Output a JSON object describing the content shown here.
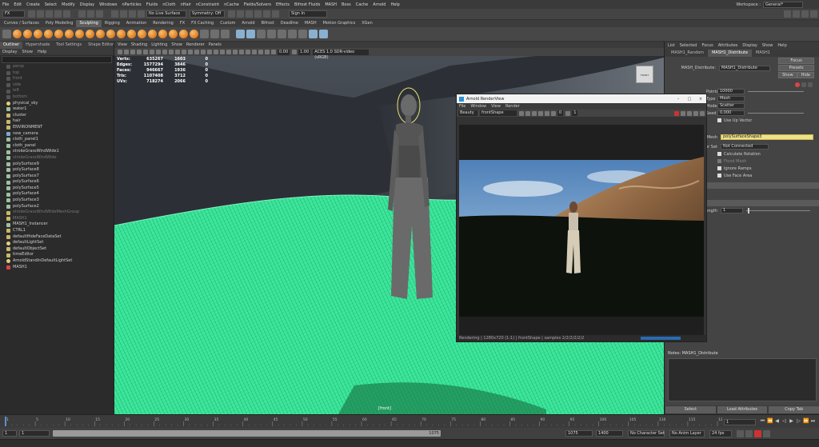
{
  "menubar": {
    "items": [
      "File",
      "Edit",
      "Create",
      "Select",
      "Modify",
      "Display",
      "Windows",
      "nParticles",
      "Fluids",
      "nCloth",
      "nHair",
      "nConstraint",
      "nCache",
      "Fields/Solvers",
      "Effects",
      "Bifrost Fluids",
      "MASH",
      "Boss",
      "Cache",
      "Arnold",
      "Help"
    ],
    "workspace_label": "Workspace :",
    "workspace_value": "General*"
  },
  "statusline": {
    "mode": "FX",
    "live_surface": "No Live Surface",
    "symmetry": "Symmetry: Off",
    "sign_in": "Sign In"
  },
  "shelf_tabs": [
    "Curves / Surfaces",
    "Poly Modeling",
    "Sculpting",
    "Rigging",
    "Animation",
    "Rendering",
    "FX",
    "FX Caching",
    "Custom",
    "Arnold",
    "Bifrost",
    "Deadline",
    "MASH",
    "Motion Graphics",
    "XGen"
  ],
  "shelf_active": "Sculpting",
  "outliner": {
    "tabs": [
      "Outliner",
      "Hypershade",
      "Tool Settings",
      "Shape Editor"
    ],
    "menu": [
      "Display",
      "Show",
      "Help"
    ],
    "items": [
      {
        "name": "persp",
        "icon": "camera",
        "dim": true
      },
      {
        "name": "top",
        "icon": "camera",
        "dim": true
      },
      {
        "name": "front",
        "icon": "camera",
        "dim": true
      },
      {
        "name": "side",
        "icon": "camera",
        "dim": true
      },
      {
        "name": "left",
        "icon": "camera",
        "dim": true
      },
      {
        "name": "bottom",
        "icon": "camera",
        "dim": true
      },
      {
        "name": "physical_sky",
        "icon": "light",
        "dim": false
      },
      {
        "name": "water1",
        "icon": "mesh",
        "dim": false
      },
      {
        "name": "cluster",
        "icon": "grp",
        "dim": false
      },
      {
        "name": "hair",
        "icon": "grp",
        "dim": false
      },
      {
        "name": "ENVIRONMENT",
        "icon": "grp",
        "dim": false
      },
      {
        "name": "new_camera",
        "icon": "camera",
        "dim": false
      },
      {
        "name": "cloth_panel1",
        "icon": "mesh",
        "dim": false
      },
      {
        "name": "cloth_panel",
        "icon": "mesh",
        "dim": false
      },
      {
        "name": "strokeGrassWindWide1",
        "icon": "mesh",
        "dim": false
      },
      {
        "name": "strokeGrassWindWide",
        "icon": "mesh",
        "dim": true
      },
      {
        "name": "polySurface9",
        "icon": "mesh",
        "dim": false
      },
      {
        "name": "polySurface8",
        "icon": "mesh",
        "dim": false
      },
      {
        "name": "polySurface7",
        "icon": "mesh",
        "dim": false
      },
      {
        "name": "polySurface6",
        "icon": "mesh",
        "dim": false
      },
      {
        "name": "polySurface5",
        "icon": "mesh",
        "dim": false
      },
      {
        "name": "polySurface4",
        "icon": "mesh",
        "dim": false
      },
      {
        "name": "polySurface3",
        "icon": "mesh",
        "dim": false
      },
      {
        "name": "polySurface2",
        "icon": "mesh",
        "dim": false
      },
      {
        "name": "strokeGrassWindWideMeshGroup",
        "icon": "grp",
        "dim": true
      },
      {
        "name": "MASH1",
        "icon": "grp",
        "dim": true
      },
      {
        "name": "MASH1_Instancer",
        "icon": "mesh",
        "dim": false
      },
      {
        "name": "CTRL1",
        "icon": "grp",
        "dim": false
      },
      {
        "name": "defaultHideFaceDataSet",
        "icon": "grp",
        "dim": false
      },
      {
        "name": "defaultLightSet",
        "icon": "light",
        "dim": false
      },
      {
        "name": "defaultObjectSet",
        "icon": "grp",
        "dim": false
      },
      {
        "name": "timeEditor",
        "icon": "grp",
        "dim": false
      },
      {
        "name": "ArnoldStandInDefaultLightSet",
        "icon": "light",
        "dim": false
      },
      {
        "name": "MASH1",
        "icon": "red",
        "dim": false
      }
    ]
  },
  "viewport": {
    "menu": [
      "View",
      "Shading",
      "Lighting",
      "Show",
      "Renderer",
      "Panels"
    ],
    "tool_values": [
      "0.00",
      "1.00",
      "ACES 1.0 SDR-video (sRGB)"
    ],
    "hud": [
      {
        "label": "Verts:",
        "a": "635267",
        "b": "1603",
        "c": "0"
      },
      {
        "label": "Edges:",
        "a": "1577294",
        "b": "3846",
        "c": "0"
      },
      {
        "label": "Faces:",
        "a": "946667",
        "b": "1936",
        "c": "0"
      },
      {
        "label": "Tris:",
        "a": "1107408",
        "b": "3712",
        "c": "0"
      },
      {
        "label": "UVs:",
        "a": "718274",
        "b": "2066",
        "c": "0"
      }
    ],
    "camera_label": "[front]",
    "viewcube_label": "FRONT"
  },
  "renderview": {
    "title": "Arnold RenderView",
    "menu": [
      "File",
      "Window",
      "View",
      "Render"
    ],
    "aov": "Beauty",
    "camera": "frontShape",
    "exposure": "0",
    "gamma": "1",
    "status": "Rendering | 1280x720 (1:1) | frontShape | samples 2/2/2/2/2/2"
  },
  "attr": {
    "menu": [
      "List",
      "Selected",
      "Focus",
      "Attributes",
      "Display",
      "Show",
      "Help"
    ],
    "tabs": [
      "MASH1_Random",
      "MASH1_Distribute",
      "MASH1"
    ],
    "node_label": "MASH_Distribute:",
    "node_value": "MASH1_Distribute",
    "focus_btn": "Focus",
    "presets_btn": "Presets",
    "show_btn": "Show",
    "hide_btn": "Hide",
    "rows": [
      {
        "label": "Points",
        "value": "10000"
      },
      {
        "label": "Type",
        "value": "Mesh"
      },
      {
        "label": "Mode",
        "value": "Scatter"
      },
      {
        "label": "Seed",
        "value": "0.000"
      }
    ],
    "use_up_vector": "Use Up Vector",
    "mesh_label": "Mesh",
    "mesh_value": "polySurfaceShape3",
    "color_set_label": "Color Set",
    "color_set_value": "Not Connected",
    "checks": [
      "Calculate Rotation",
      "Flood Mesh",
      "Ignore Ramps",
      "Use Face Area"
    ],
    "strength_label": "Strength",
    "strength_value": "1",
    "notes_title": "Notes: MASH1_Distribute",
    "bottom_buttons": [
      "Select",
      "Load Attributes",
      "Copy Tab"
    ]
  },
  "timeslider": {
    "ticks": [
      "1",
      "5",
      "10",
      "15",
      "20",
      "25",
      "30",
      "35",
      "40",
      "45",
      "50",
      "55",
      "60",
      "65",
      "70",
      "75",
      "80",
      "85",
      "90",
      "95",
      "100",
      "105",
      "110",
      "115",
      "120"
    ],
    "current_frame": "1"
  },
  "rangeslider": {
    "start": "1",
    "anim_start": "1",
    "range_end": "1075",
    "end_a": "1075",
    "end_b": "1400",
    "char_set": "No Character Set",
    "anim_layer": "No Anim Layer",
    "fps": "24 fps"
  },
  "colors": {
    "grass": "#3de89a",
    "maya_blue": "#2c8fd8",
    "highlight_yellow": "#efe08a"
  }
}
